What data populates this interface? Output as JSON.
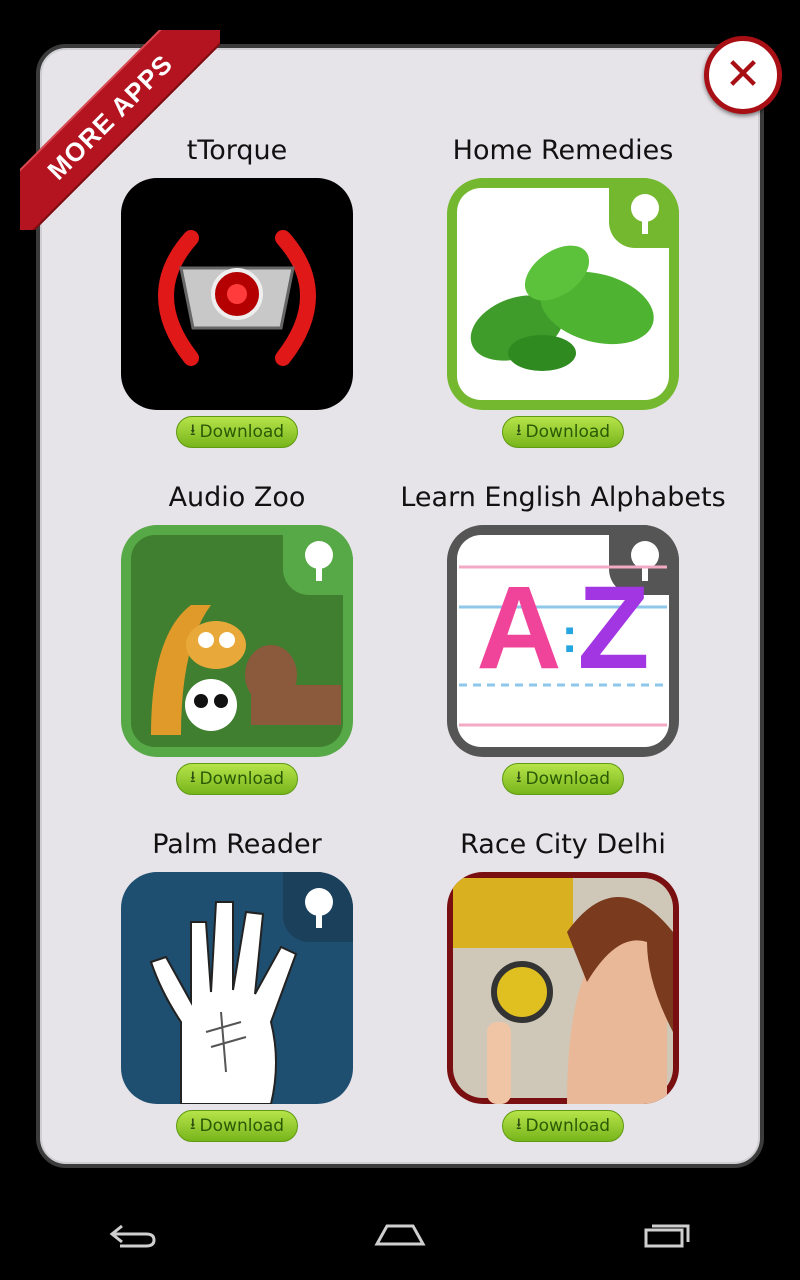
{
  "ribbon": {
    "label": "MORE APPS"
  },
  "close": {
    "glyph": "✕"
  },
  "apps": [
    {
      "title": "tTorque",
      "download_label": "Download"
    },
    {
      "title": "Home Remedies",
      "download_label": "Download"
    },
    {
      "title": "Audio Zoo",
      "download_label": "Download"
    },
    {
      "title": "Learn English Alphabets",
      "download_label": "Download"
    },
    {
      "title": "Palm Reader",
      "download_label": "Download"
    },
    {
      "title": "Race City Delhi",
      "download_label": "Download"
    }
  ],
  "icons": {
    "alphabet_letters": {
      "first": "A",
      "sep": ":",
      "last": "Z"
    }
  },
  "colors": {
    "accent_red": "#a80f15",
    "download_green": "#8cc63f"
  }
}
